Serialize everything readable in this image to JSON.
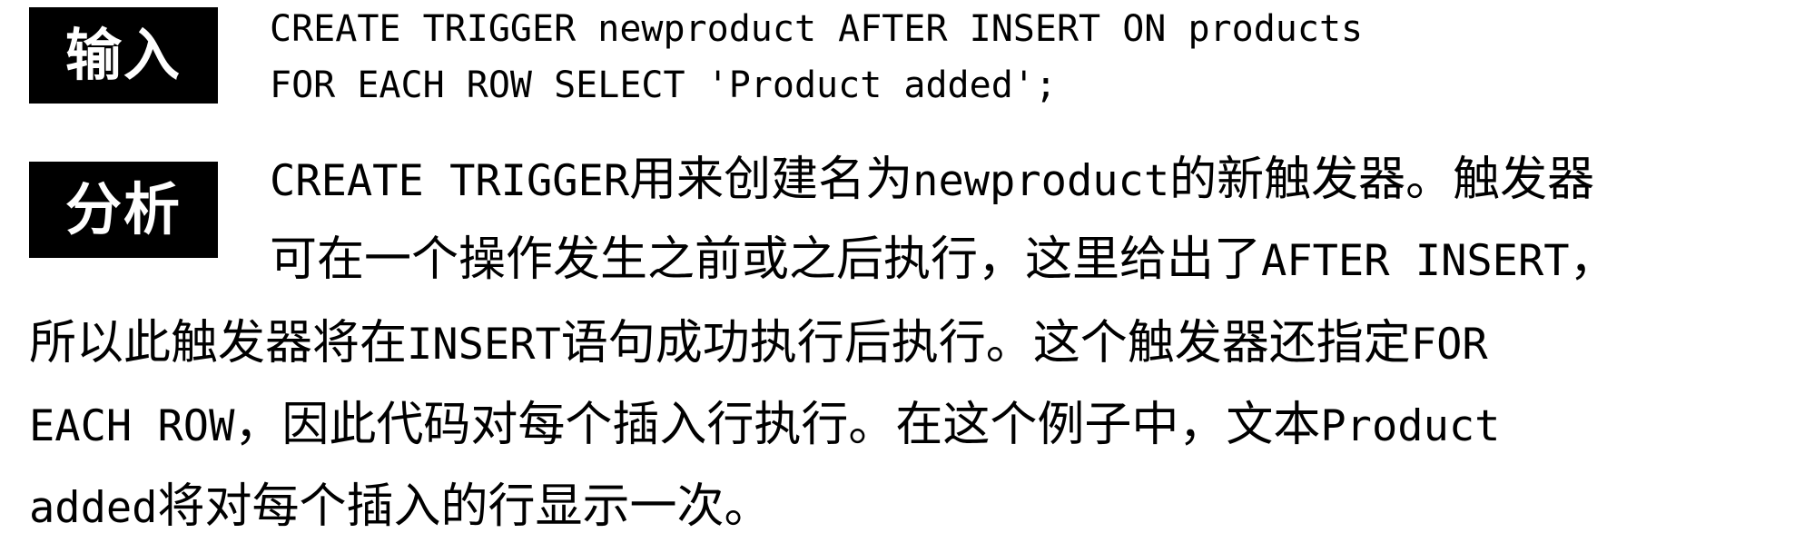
{
  "labels": {
    "input": "输入",
    "analysis": "分析"
  },
  "code": {
    "line1": "CREATE TRIGGER newproduct AFTER INSERT ON products",
    "line2": "FOR EACH ROW SELECT 'Product added';"
  },
  "analysis": {
    "l1_kw1": "CREATE TRIGGER",
    "l1_t1": "用来创建名为",
    "l1_kw2": "newproduct",
    "l1_t2": "的新触发器。触发器",
    "l2_t1": "可在一个操作发生之前或之后执行，这里给出了",
    "l2_kw1": "AFTER INSERT",
    "l2_t2": "，",
    "l3_t1": "所以此触发器将在",
    "l3_kw1": "INSERT",
    "l3_t2": "语句成功执行后执行。这个触发器还指定",
    "l3_kw2": "FOR",
    "l4_kw1": "EACH ROW",
    "l4_t1": "，因此代码对每个插入行执行。在这个例子中，文本",
    "l4_kw2": "Product",
    "l5_kw1": "added",
    "l5_t1": "将对每个插入的行显示一次。"
  }
}
